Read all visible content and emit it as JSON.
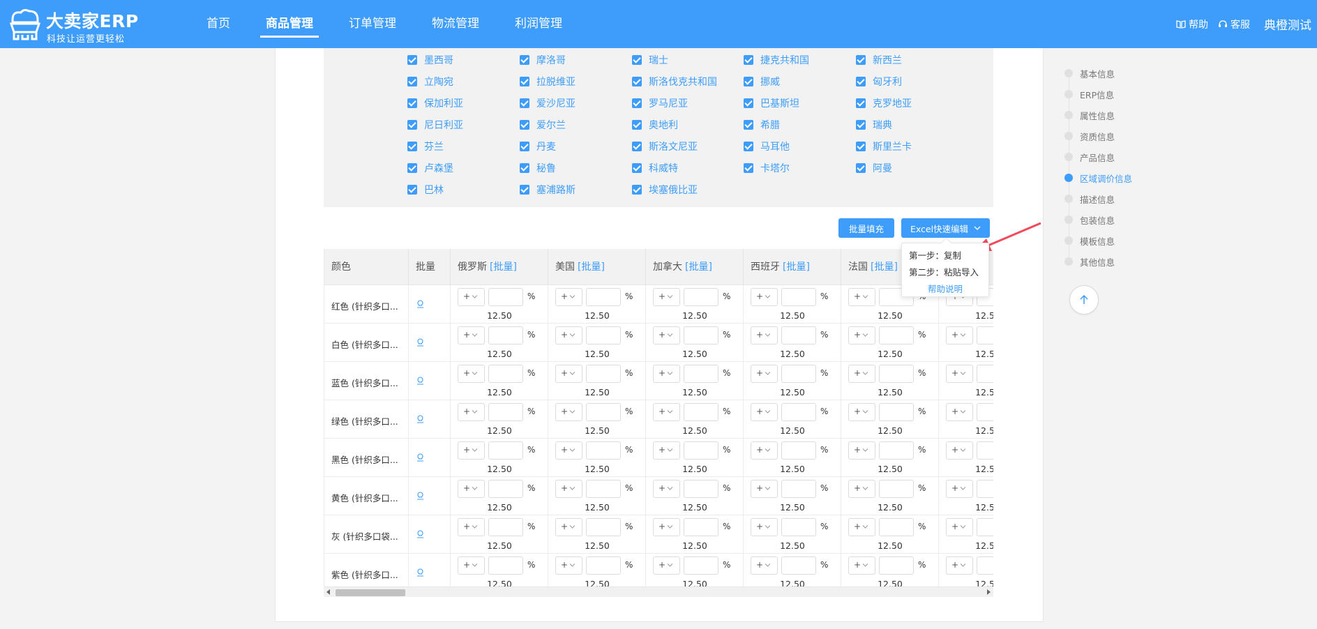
{
  "header": {
    "brand": "大卖家ERP",
    "slogan": "科技让运营更轻松",
    "nav": [
      "首页",
      "商品管理",
      "订单管理",
      "物流管理",
      "利润管理"
    ],
    "active_nav": "商品管理",
    "help": "帮助",
    "service": "客服",
    "user": "典橙测试"
  },
  "countries": [
    [
      "墨西哥",
      "摩洛哥",
      "瑞士",
      "捷克共和国",
      "新西兰"
    ],
    [
      "立陶宛",
      "拉脱维亚",
      "斯洛伐克共和国",
      "挪威",
      "匈牙利"
    ],
    [
      "保加利亚",
      "爱沙尼亚",
      "罗马尼亚",
      "巴基斯坦",
      "克罗地亚"
    ],
    [
      "尼日利亚",
      "爱尔兰",
      "奥地利",
      "希腊",
      "瑞典"
    ],
    [
      "芬兰",
      "丹麦",
      "斯洛文尼亚",
      "马耳他",
      "斯里兰卡"
    ],
    [
      "卢森堡",
      "秘鲁",
      "科威特",
      "卡塔尔",
      "阿曼"
    ],
    [
      "巴林",
      "塞浦路斯",
      "埃塞俄比亚"
    ]
  ],
  "actions": {
    "batch_fill": "批量填充",
    "excel_edit": "Excel快速编辑"
  },
  "excel_dropdown": {
    "step1": "第一步：复制",
    "step2": "第二步：粘贴导入",
    "help": "帮助说明"
  },
  "table": {
    "col_color": "颜色",
    "col_batch": "批量",
    "batch_link": "[批量]",
    "countries": [
      "俄罗斯",
      "美国",
      "加拿大",
      "西班牙",
      "法国"
    ],
    "rows": [
      {
        "color": "红色 (针织多口...",
        "price": "12.50"
      },
      {
        "color": "白色 (针织多口...",
        "price": "12.50"
      },
      {
        "color": "蓝色 (针织多口...",
        "price": "12.50"
      },
      {
        "color": "绿色 (针织多口...",
        "price": "12.50"
      },
      {
        "color": "黑色 (针织多口...",
        "price": "12.50"
      },
      {
        "color": "黄色 (针织多口...",
        "price": "12.50"
      },
      {
        "color": "灰 (针织多口袋...",
        "price": "12.50"
      },
      {
        "color": "紫色 (针织多口...",
        "price": "12.50"
      }
    ],
    "operator": "+",
    "percent": "%"
  },
  "anchors": [
    "基本信息",
    "ERP信息",
    "属性信息",
    "资质信息",
    "产品信息",
    "区域调价信息",
    "描述信息",
    "包装信息",
    "模板信息",
    "其他信息"
  ],
  "active_anchor": "区域调价信息",
  "colors": {
    "primary": "#3e9dfa",
    "annotation": "#f14a5c"
  }
}
